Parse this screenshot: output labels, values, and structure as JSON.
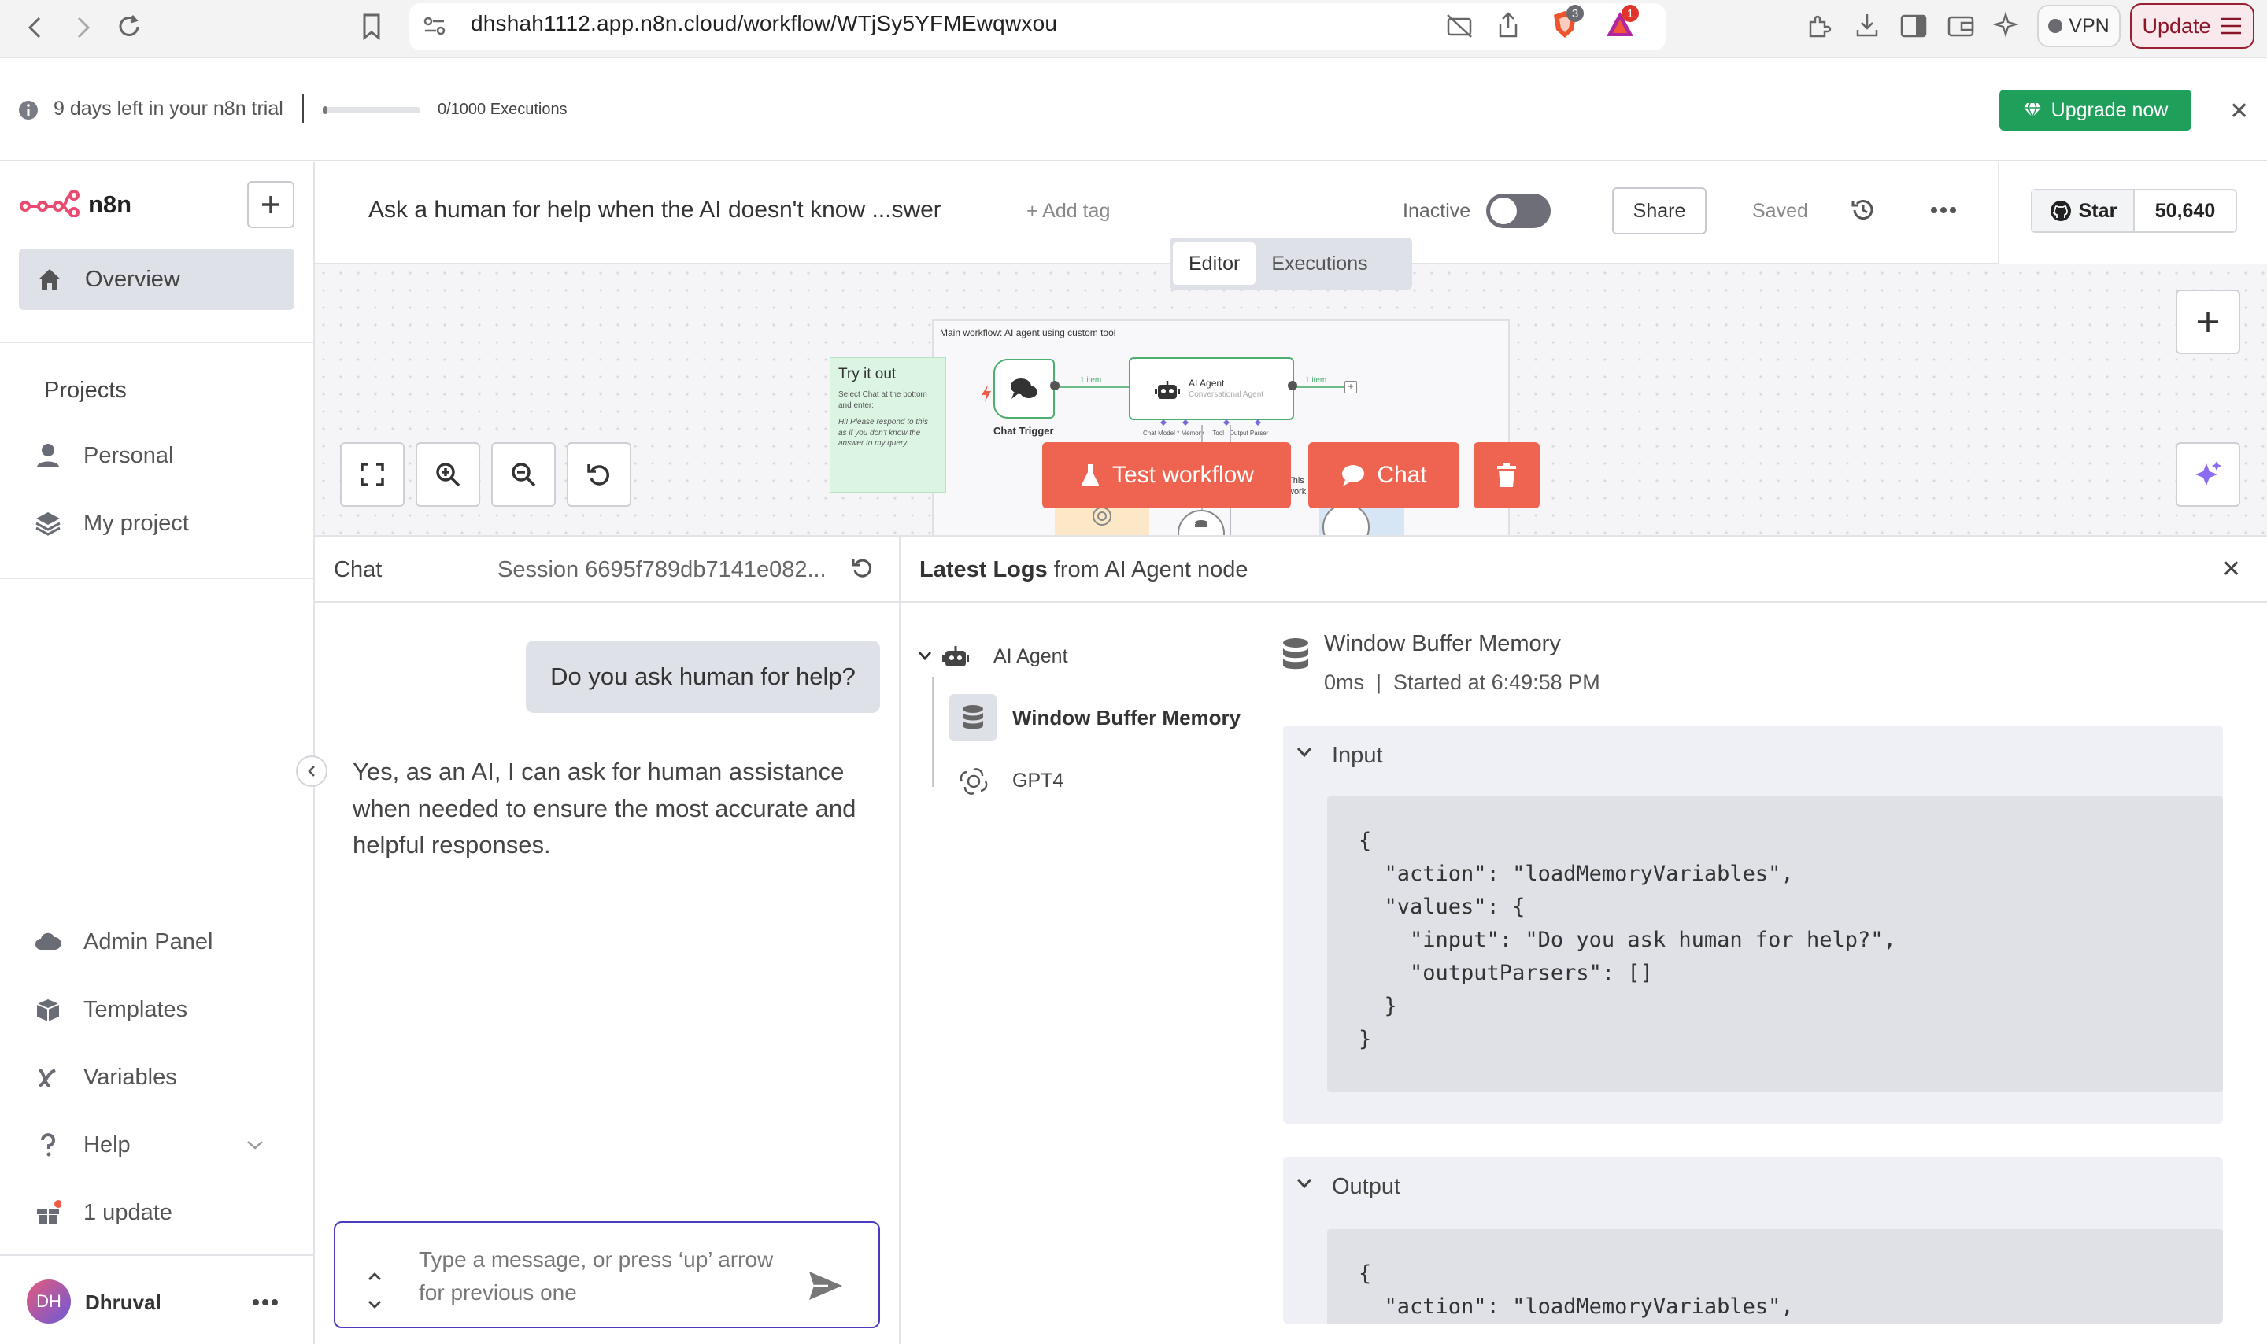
{
  "browser": {
    "url": "dhshah1112.app.n8n.cloud/workflow/WTjSy5YFMEwqwxou",
    "badge_shield": "3",
    "badge_alert": "1",
    "vpn_label": "VPN",
    "update_label": "Update"
  },
  "trial": {
    "message": "9 days left in your n8n trial",
    "executions": "0/1000 Executions",
    "executions_used_fraction": 0.0,
    "upgrade_label": "Upgrade now"
  },
  "sidebar": {
    "brand": "n8n",
    "overview": "Overview",
    "projects_heading": "Projects",
    "projects": [
      {
        "label": "Personal",
        "icon": "user-icon"
      },
      {
        "label": "My project",
        "icon": "layers-icon"
      }
    ],
    "bottom_items": [
      {
        "label": "Admin Panel",
        "icon": "cloud-icon"
      },
      {
        "label": "Templates",
        "icon": "box-icon"
      },
      {
        "label": "Variables",
        "icon": "variable-icon"
      },
      {
        "label": "Help",
        "icon": "question-icon"
      },
      {
        "label": "1 update",
        "icon": "gift-icon"
      }
    ],
    "user": {
      "initials": "DH",
      "name": "Dhruval"
    }
  },
  "workflow": {
    "title": "Ask a human for help when the AI doesn't know ...swer",
    "add_tag": "+ Add tag",
    "status_label": "Inactive",
    "active": false,
    "share_label": "Share",
    "saved_label": "Saved",
    "github_star": "Star",
    "github_count": "50,640"
  },
  "tabs": [
    {
      "label": "Editor",
      "active": true
    },
    {
      "label": "Executions",
      "active": false
    }
  ],
  "canvas": {
    "sticky_note": {
      "title": "Try it out",
      "subtitle": "Select Chat at the bottom and enter:",
      "italic": "Hi! Please respond to this as if you don't know the answer to my query."
    },
    "main_note_title": "Main workflow: AI agent using custom tool",
    "chat_trigger_label": "Chat Trigger",
    "agent_title": "AI Agent",
    "agent_subtitle": "Conversational Agent",
    "edge_label_1": "1 item",
    "edge_label_2": "1 item",
    "agent_ports": "Chat Model * Memory     Tool   Output Parser",
    "partial_note": "This\nwork",
    "test_workflow": "Test workflow",
    "chat_button": "Chat"
  },
  "chat": {
    "label": "Chat",
    "session": "Session  6695f789db7141e082...",
    "user_message": "Do you ask human for help?",
    "bot_message": "Yes, as an AI, I can ask for human assistance when needed to ensure the most accurate and helpful responses.",
    "input_placeholder": "Type a message, or press ‘up’ arrow for previous one"
  },
  "logs": {
    "title_bold": "Latest Logs",
    "title_rest": " from AI Agent node",
    "tree": {
      "root": "AI Agent",
      "children": [
        "Window Buffer Memory",
        "GPT4"
      ]
    },
    "selected_node": "Window Buffer Memory",
    "meta": "0ms  |  Started at 6:49:58 PM",
    "input_label": "Input",
    "input_json": "{\n  \"action\": \"loadMemoryVariables\",\n  \"values\": {\n    \"input\": \"Do you ask human for help?\",\n    \"outputParsers\": []\n  }\n}",
    "output_label": "Output",
    "output_json": "{\n  \"action\": \"loadMemoryVariables\","
  },
  "colors": {
    "brand": "#ea4b71",
    "accent_red": "#ee6450",
    "upgrade_green": "#1e9f5a",
    "input_border": "#4b3bbf"
  }
}
